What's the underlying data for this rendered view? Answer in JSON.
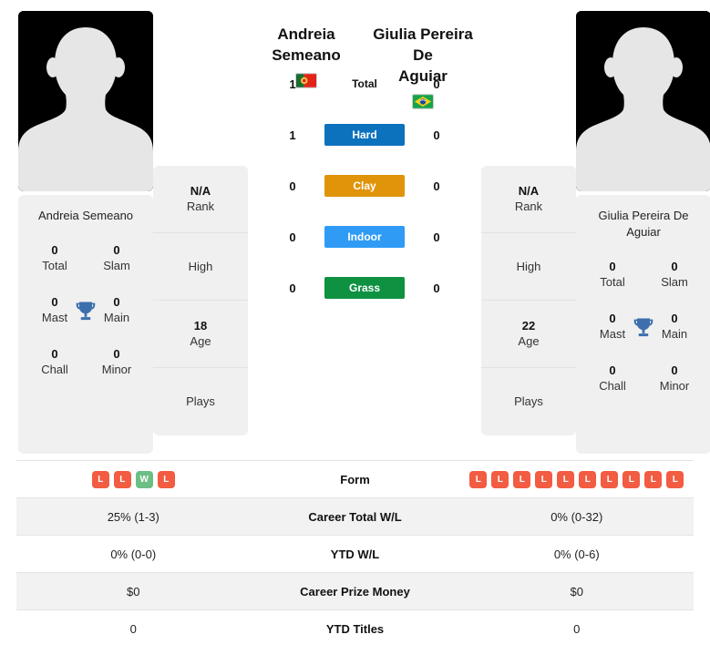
{
  "players": {
    "left": {
      "name": "Andreia Semeano",
      "name_line1": "Andreia",
      "name_line2": "Semeano",
      "country": "Portugal",
      "flag": "portugal-flag",
      "photo": "player-photo-placeholder",
      "honours": {
        "title": "Andreia Semeano",
        "items": [
          {
            "value": "0",
            "label": "Total"
          },
          {
            "value": "0",
            "label": "Slam"
          },
          {
            "value": "0",
            "label": "Mast"
          },
          {
            "value": "0",
            "label": "Main"
          },
          {
            "value": "0",
            "label": "Chall"
          },
          {
            "value": "0",
            "label": "Minor"
          }
        ],
        "icon": "trophy-icon"
      },
      "info": [
        {
          "value": "N/A",
          "label": "Rank"
        },
        {
          "value": "",
          "label": "High"
        },
        {
          "value": "18",
          "label": "Age"
        },
        {
          "value": "",
          "label": "Plays"
        }
      ],
      "form": [
        "L",
        "L",
        "W",
        "L"
      ],
      "career_total_wl": "25% (1-3)",
      "ytd_wl": "0% (0-0)",
      "career_prize_money": "$0",
      "ytd_titles": "0"
    },
    "right": {
      "name": "Giulia Pereira De Aguiar",
      "name_line1": "Giulia Pereira De",
      "name_line2": "Aguiar",
      "country": "Brazil",
      "flag": "brazil-flag",
      "photo": "player-photo-placeholder",
      "honours": {
        "title": "Giulia Pereira De Aguiar",
        "items": [
          {
            "value": "0",
            "label": "Total"
          },
          {
            "value": "0",
            "label": "Slam"
          },
          {
            "value": "0",
            "label": "Mast"
          },
          {
            "value": "0",
            "label": "Main"
          },
          {
            "value": "0",
            "label": "Chall"
          },
          {
            "value": "0",
            "label": "Minor"
          }
        ],
        "icon": "trophy-icon"
      },
      "info": [
        {
          "value": "N/A",
          "label": "Rank"
        },
        {
          "value": "",
          "label": "High"
        },
        {
          "value": "22",
          "label": "Age"
        },
        {
          "value": "",
          "label": "Plays"
        }
      ],
      "form": [
        "L",
        "L",
        "L",
        "L",
        "L",
        "L",
        "L",
        "L",
        "L",
        "L"
      ],
      "career_total_wl": "0% (0-32)",
      "ytd_wl": "0% (0-6)",
      "career_prize_money": "$0",
      "ytd_titles": "0"
    }
  },
  "head_to_head": {
    "rows": [
      {
        "label": "Total",
        "left": "1",
        "right": "0",
        "color": "",
        "plain": true
      },
      {
        "label": "Hard",
        "left": "1",
        "right": "0",
        "color": "#0c72be",
        "plain": false
      },
      {
        "label": "Clay",
        "left": "0",
        "right": "0",
        "color": "#e0940a",
        "plain": false
      },
      {
        "label": "Indoor",
        "left": "0",
        "right": "0",
        "color": "#2f9bf5",
        "plain": false
      },
      {
        "label": "Grass",
        "left": "0",
        "right": "0",
        "color": "#0f9142",
        "plain": false
      }
    ]
  },
  "stats_table": {
    "rows": [
      {
        "label": "Form",
        "left": "",
        "right": ""
      },
      {
        "label": "Career Total W/L",
        "left": "25% (1-3)",
        "right": "0% (0-32)"
      },
      {
        "label": "YTD W/L",
        "left": "0% (0-0)",
        "right": "0% (0-6)"
      },
      {
        "label": "Career Prize Money",
        "left": "$0",
        "right": "$0"
      },
      {
        "label": "YTD Titles",
        "left": "0",
        "right": "0"
      }
    ]
  },
  "colors": {
    "win": "#6cbf84",
    "loss": "#f25c42",
    "trophy": "#3d6fad",
    "card_bg": "#f0f0f0",
    "row_alt": "#f2f2f2"
  }
}
